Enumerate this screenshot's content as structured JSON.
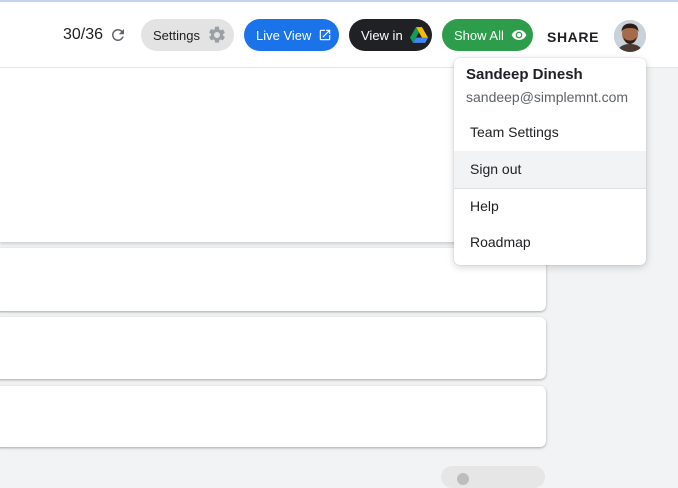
{
  "toolbar": {
    "counter": "30/36",
    "settings_label": "Settings",
    "live_view_label": "Live View",
    "view_in_label": "View in",
    "show_all_label": "Show All",
    "share_label": "SHARE"
  },
  "account_menu": {
    "name": "Sandeep Dinesh",
    "email": "sandeep@simplemnt.com",
    "items": [
      {
        "label": "Team Settings"
      },
      {
        "label": "Sign out",
        "highlighted": true
      },
      {
        "label": "Help"
      },
      {
        "label": "Roadmap"
      }
    ]
  },
  "colors": {
    "live_view": "#1a73e8",
    "view_in": "#202124",
    "show_all": "#2e9d4b",
    "settings": "#e3e3e3"
  },
  "icons": {
    "refresh": "refresh-icon",
    "gear": "gear-icon",
    "external_link": "external-link-icon",
    "drive": "google-drive-icon",
    "eye": "eye-icon"
  }
}
